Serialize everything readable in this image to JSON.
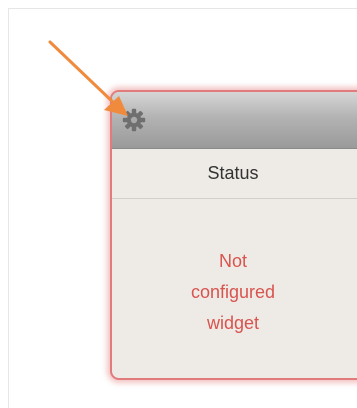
{
  "widget": {
    "title": "Status",
    "message_lines": [
      "Not",
      "configured",
      "widget"
    ],
    "settings_icon": "gear-icon"
  },
  "annotation": {
    "icon": "arrow-icon",
    "color": "#f08a3c"
  },
  "colors": {
    "border": "#e27b7b",
    "message": "#d9534f",
    "body": "#eeebe6"
  }
}
